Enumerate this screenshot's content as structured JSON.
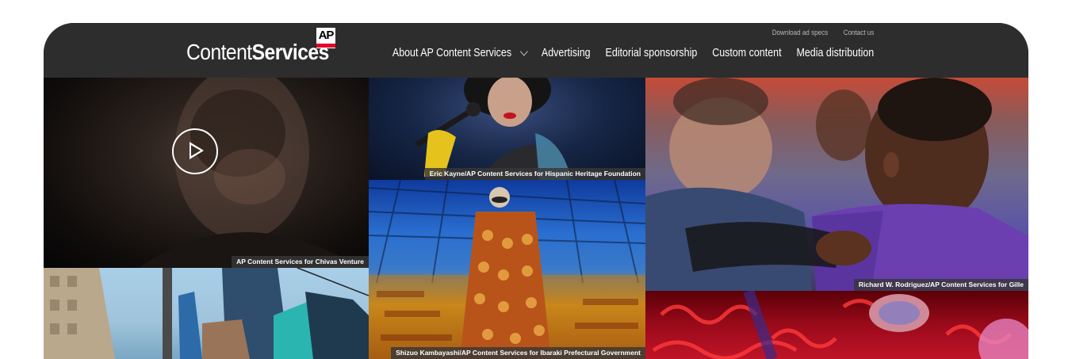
{
  "brand": {
    "logo_text_light": "Content",
    "logo_text_bold": "Services",
    "badge_text": "AP"
  },
  "utility_links": [
    "Download ad specs",
    "Contact us"
  ],
  "nav": {
    "items": [
      {
        "label": "About AP Content Services",
        "dropdown": true
      },
      {
        "label": "Advertising",
        "dropdown": false
      },
      {
        "label": "Editorial sponsorship",
        "dropdown": false
      },
      {
        "label": "Custom content",
        "dropdown": false
      },
      {
        "label": "Media distribution",
        "dropdown": false
      }
    ]
  },
  "gallery": {
    "tiles": [
      {
        "id": "chivas",
        "caption": "AP Content Services for Chivas Venture",
        "has_video": true
      },
      {
        "id": "singer",
        "caption": "Eric Kayne/AP Content Services for Hispanic Heritage Foundation"
      },
      {
        "id": "textile",
        "caption": "Shizuo Kambayashi/AP Content Services for Ibaraki Prefectural Government"
      },
      {
        "id": "students",
        "caption": "Richard W. Rodriguez/AP Content Services for Gille"
      },
      {
        "id": "city",
        "caption": ""
      },
      {
        "id": "cells",
        "caption": ""
      }
    ]
  },
  "colors": {
    "header_bg": "#2d2d2d",
    "ap_red": "#e4002b",
    "nav_text": "#ffffff",
    "utility_text": "#b9b9b9"
  },
  "icons": {
    "play": "play-icon",
    "dropdown": "chevron-down-icon"
  }
}
